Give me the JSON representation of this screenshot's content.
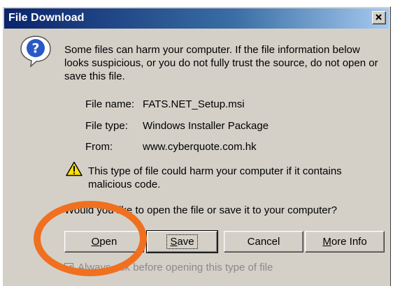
{
  "dialog": {
    "title": "File Download",
    "close_glyph": "✕",
    "warning_text": "Some files can harm your computer. If the file information below looks suspicious, or you do not fully trust the source, do not open or save this file.",
    "question_icon": "question-icon",
    "warning_icon": "warning-icon"
  },
  "file_info": {
    "name_label": "File name:",
    "name_value": "FATS.NET_Setup.msi",
    "type_label": "File type:",
    "type_value": "Windows Installer Package",
    "from_label": "From:",
    "from_value": "www.cyberquote.com.hk"
  },
  "harm_notice": "This type of file could harm your computer if it contains malicious code.",
  "prompt": "Would you like to open the file or save it to your computer?",
  "buttons": {
    "open_u": "O",
    "open_rest": "pen",
    "save_u": "S",
    "save_rest": "ave",
    "cancel": "Cancel",
    "more_u": "M",
    "more_rest": "ore Info"
  },
  "checkbox": {
    "label": "Always ask before opening this type of file",
    "checked": true
  },
  "colors": {
    "titlebar_start": "#0a246a",
    "dialog_bg": "#d4d0c8",
    "annotation_ring": "#f07020"
  }
}
